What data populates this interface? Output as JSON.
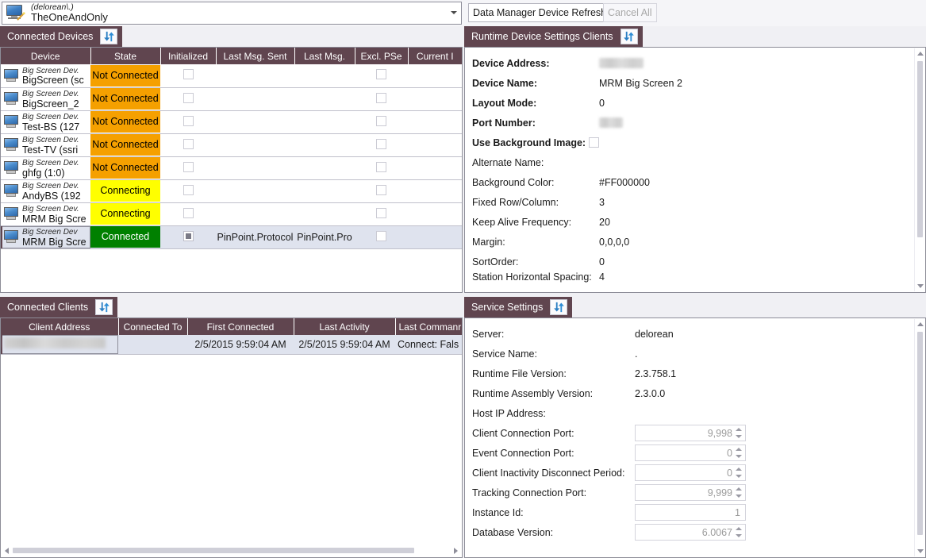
{
  "topbar": {
    "combo": {
      "line1": "(delorean\\.)",
      "line2": "TheOneAndOnly",
      "icon": "computer-wand-icon"
    },
    "buttons": [
      {
        "label": "Data Manager Device Refresh",
        "enabled": true
      },
      {
        "label": "Cancel All",
        "enabled": false
      }
    ]
  },
  "panels": {
    "connected_devices": {
      "title": "Connected Devices",
      "refresh_icon": "refresh-arrows-icon",
      "columns": [
        "Device",
        "State",
        "Initialized",
        "Last Msg. Sent",
        "Last Msg.",
        "Excl. PSе",
        "Current I"
      ],
      "rows": [
        {
          "type_label": "Big Screen Dev.",
          "name": "BigScreen (sс",
          "state": "Not Connected",
          "state_kind": "notconnected",
          "initialized": false,
          "initialized_filled": false,
          "last_msg_sent": "",
          "last_msg": "",
          "excl_ps": false,
          "current_i": ""
        },
        {
          "type_label": "Big Screen Dev.",
          "name": "BigScreen_2",
          "state": "Not Connected",
          "state_kind": "notconnected",
          "initialized": false,
          "initialized_filled": false,
          "last_msg_sent": "",
          "last_msg": "",
          "excl_ps": false,
          "current_i": ""
        },
        {
          "type_label": "Big Screen Dev.",
          "name": "Test-BS (127",
          "state": "Not Connected",
          "state_kind": "notconnected",
          "initialized": false,
          "initialized_filled": false,
          "last_msg_sent": "",
          "last_msg": "",
          "excl_ps": false,
          "current_i": ""
        },
        {
          "type_label": "Big Screen Dev.",
          "name": "Test-TV (ssri",
          "state": "Not Connected",
          "state_kind": "notconnected",
          "initialized": false,
          "initialized_filled": false,
          "last_msg_sent": "",
          "last_msg": "",
          "excl_ps": false,
          "current_i": ""
        },
        {
          "type_label": "Big Screen Dev.",
          "name": "ghfg (1:0)",
          "state": "Not Connected",
          "state_kind": "notconnected",
          "initialized": false,
          "initialized_filled": false,
          "last_msg_sent": "",
          "last_msg": "",
          "excl_ps": false,
          "current_i": ""
        },
        {
          "type_label": "Big Screen Dev.",
          "name": "AndyBS (192",
          "state": "Connecting",
          "state_kind": "connecting",
          "initialized": false,
          "initialized_filled": false,
          "last_msg_sent": "",
          "last_msg": "",
          "excl_ps": false,
          "current_i": ""
        },
        {
          "type_label": "Big Screen Dev.",
          "name": "MRM Big Scre",
          "state": "Connecting",
          "state_kind": "connecting",
          "initialized": false,
          "initialized_filled": false,
          "last_msg_sent": "",
          "last_msg": "",
          "excl_ps": false,
          "current_i": ""
        },
        {
          "type_label": "Big Screen Dev",
          "name": "MRM Big Scre",
          "state": "Connected",
          "state_kind": "connected",
          "initialized": true,
          "initialized_filled": true,
          "last_msg_sent": "PinPoint.Protocol",
          "last_msg": "PinPoint.Pro",
          "excl_ps": false,
          "current_i": ""
        }
      ],
      "selected_row_index": 7
    },
    "runtime_device_settings": {
      "title": "Runtime Device Settings Clients",
      "refresh_icon": "refresh-arrows-icon",
      "fields": [
        {
          "label": "Device Address:",
          "value": "",
          "bold": true,
          "redacted": true,
          "redact_width": 56
        },
        {
          "label": "Device Name:",
          "value": "MRM Big Screen 2",
          "bold": true,
          "redacted": false
        },
        {
          "label": "Layout Mode:",
          "value": "0",
          "bold": true,
          "redacted": false
        },
        {
          "label": "Port Number:",
          "value": "",
          "bold": true,
          "redacted": true,
          "redact_width": 30
        },
        {
          "label": "Use Background Image:",
          "value": "",
          "bold": true,
          "checkbox": true,
          "checked": false
        },
        {
          "label": "Alternate Name:",
          "value": "",
          "bold": false,
          "redacted": false
        },
        {
          "label": "Background Color:",
          "value": "#FF000000",
          "bold": false,
          "redacted": false
        },
        {
          "label": "Fixed Row/Column:",
          "value": "3",
          "bold": false,
          "redacted": false
        },
        {
          "label": "Keep Alive Frequency:",
          "value": "20",
          "bold": false,
          "redacted": false
        },
        {
          "label": "Margin:",
          "value": "0,0,0,0",
          "bold": false,
          "redacted": false
        },
        {
          "label": "SortOrder:",
          "value": "0",
          "bold": false,
          "redacted": false
        },
        {
          "label": "Station Horizontal Spacing:",
          "value": "4",
          "bold": false,
          "redacted": false,
          "clipped": true
        }
      ]
    },
    "connected_clients": {
      "title": "Connected Clients",
      "refresh_icon": "refresh-arrows-icon",
      "columns": [
        "Client Address",
        "Connected To",
        "First Connected",
        "Last Activity",
        "Last Commanr"
      ],
      "rows": [
        {
          "client_address": "",
          "client_address_redacted": true,
          "connected_to": "",
          "first_connected": "2/5/2015 9:59:04 AM",
          "last_activity": "2/5/2015 9:59:04 AM",
          "last_command": "Connect: Fals"
        }
      ]
    },
    "service_settings": {
      "title": "Service Settings",
      "refresh_icon": "refresh-arrows-icon",
      "fields": [
        {
          "label": "Server:",
          "value": "delorean",
          "kind": "text"
        },
        {
          "label": "Service Name:",
          "value": ".",
          "kind": "text"
        },
        {
          "label": "Runtime File Version:",
          "value": "2.3.758.1",
          "kind": "text"
        },
        {
          "label": "Runtime Assembly Version:",
          "value": "2.3.0.0",
          "kind": "text"
        },
        {
          "label": "Host IP Address:",
          "value": "",
          "kind": "text"
        },
        {
          "label": "Client Connection Port:",
          "value": "9,998",
          "kind": "spinner"
        },
        {
          "label": "Event Connection Port:",
          "value": "0",
          "kind": "spinner"
        },
        {
          "label": "Client Inactivity Disconnect Period:",
          "value": "0",
          "kind": "spinner"
        },
        {
          "label": "Tracking Connection Port:",
          "value": "9,999",
          "kind": "spinner"
        },
        {
          "label": "Instance Id:",
          "value": "1",
          "kind": "textbox"
        },
        {
          "label": "Database Version:",
          "value": "6.0067",
          "kind": "spinner"
        }
      ]
    }
  },
  "colors": {
    "header_purple": "#60454f",
    "state_not_connected": "#f5a000",
    "state_connecting": "#ffff00",
    "state_connected": "#008000",
    "selection": "#dfe3ee"
  }
}
